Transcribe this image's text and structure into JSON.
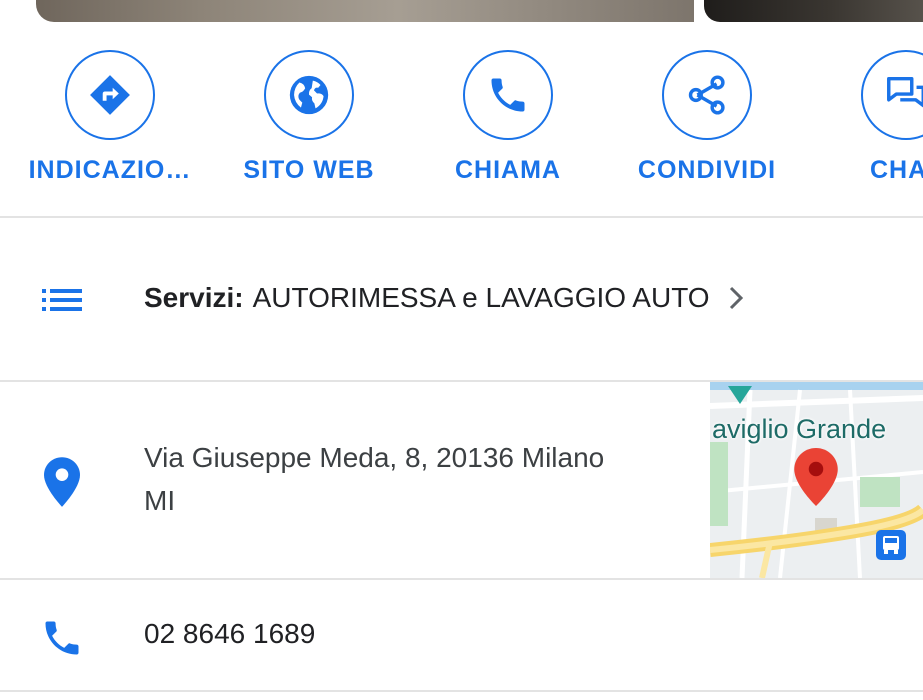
{
  "actions": [
    {
      "label": "INDICAZIO…",
      "icon": "directions-icon"
    },
    {
      "label": "SITO WEB",
      "icon": "globe-icon"
    },
    {
      "label": "CHIAMA",
      "icon": "phone-icon"
    },
    {
      "label": "CONDIVIDI",
      "icon": "share-icon"
    },
    {
      "label": "CHA",
      "icon": "chat-icon"
    }
  ],
  "services": {
    "icon": "list-icon",
    "title": "Servizi:",
    "value": "AUTORIMESSA e LAVAGGIO AUTO",
    "chevron": "chevron-right-icon"
  },
  "address": {
    "icon": "location-pin-icon",
    "line1": "Via Giuseppe Meda, 8, 20136 Milano",
    "line2": "MI",
    "map": {
      "label": "aviglio Grande",
      "pin_icon": "map-pin-icon",
      "transit_icon": "bus-icon"
    }
  },
  "phone": {
    "icon": "phone-icon",
    "number": "02 8646 1689"
  },
  "colors": {
    "accent": "#1a73e8",
    "divider": "#e3e3e3",
    "text": "#3c4043",
    "map_pin": "#ea4335"
  }
}
